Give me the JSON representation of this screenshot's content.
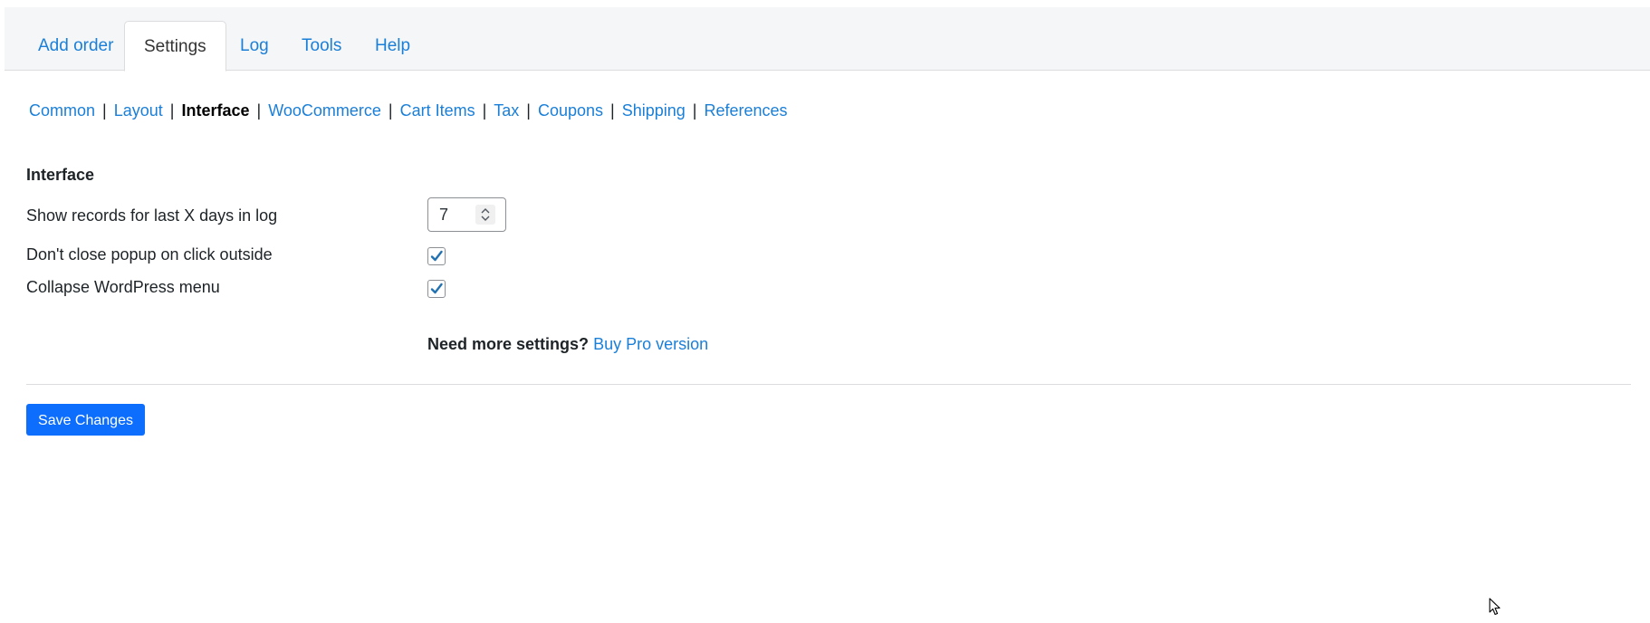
{
  "tabs": [
    {
      "label": "Add order",
      "active": false
    },
    {
      "label": "Settings",
      "active": true
    },
    {
      "label": "Log",
      "active": false
    },
    {
      "label": "Tools",
      "active": false
    },
    {
      "label": "Help",
      "active": false
    }
  ],
  "subnav": {
    "items": [
      "Common",
      "Layout",
      "Interface",
      "WooCommerce",
      "Cart Items",
      "Tax",
      "Coupons",
      "Shipping",
      "References"
    ],
    "current": "Interface",
    "separator": "|"
  },
  "section": {
    "title": "Interface"
  },
  "settings": {
    "log_days": {
      "label": "Show records for last X days in log",
      "value": "7"
    },
    "dont_close_popup": {
      "label": "Don't close popup on click outside",
      "checked": true
    },
    "collapse_wp_menu": {
      "label": "Collapse WordPress menu",
      "checked": true
    }
  },
  "promo": {
    "text": "Need more settings?",
    "link": "Buy Pro version"
  },
  "actions": {
    "save_label": "Save Changes"
  },
  "colors": {
    "link": "#1a7fd8",
    "primary_button": "#0d6efd",
    "checkmark": "#2271b1"
  },
  "icons": {
    "spinner": "up-down-chevrons-icon",
    "checkbox": "checkmark-icon",
    "cursor": "mouse-pointer-icon"
  }
}
